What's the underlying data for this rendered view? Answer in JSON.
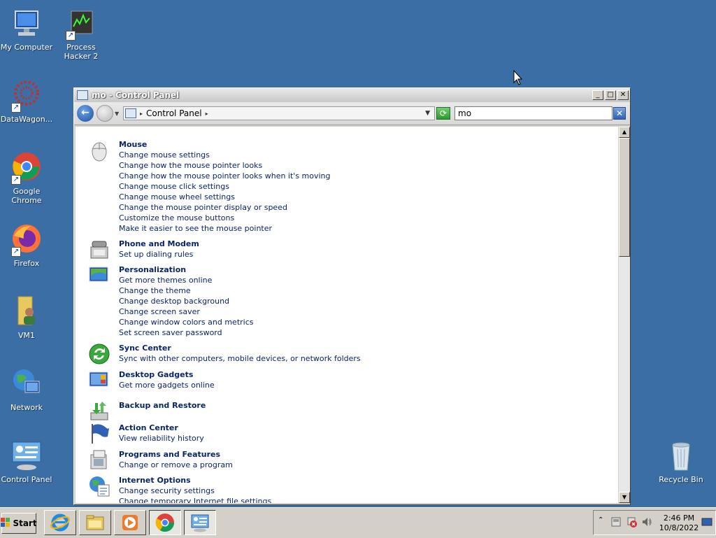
{
  "desktop": {
    "icons": [
      {
        "label": "My Computer"
      },
      {
        "label": "Process Hacker 2"
      },
      {
        "label": "DataWagon..."
      },
      {
        "label": "Google Chrome"
      },
      {
        "label": "Firefox"
      },
      {
        "label": "VM1"
      },
      {
        "label": "Network"
      },
      {
        "label": "Control Panel"
      },
      {
        "label": "Recycle Bin"
      }
    ]
  },
  "window": {
    "title": "mo - Control Panel",
    "address": "Control Panel",
    "search_value": "mo",
    "caption": {
      "minimize": "_",
      "maximize": "□",
      "close": "✕"
    }
  },
  "results": [
    {
      "title": "Mouse",
      "links": [
        "Change mouse settings",
        "Change how the mouse pointer looks",
        "Change how the mouse pointer looks when it's moving",
        "Change mouse click settings",
        "Change mouse wheel settings",
        "Change the mouse pointer display or speed",
        "Customize the mouse buttons",
        "Make it easier to see the mouse pointer"
      ]
    },
    {
      "title": "Phone and Modem",
      "links": [
        "Set up dialing rules"
      ]
    },
    {
      "title": "Personalization",
      "links": [
        "Get more themes online",
        "Change the theme",
        "Change desktop background",
        "Change screen saver",
        "Change window colors and metrics",
        "Set screen saver password"
      ]
    },
    {
      "title": "Sync Center",
      "links": [
        "Sync with other computers, mobile devices, or network folders"
      ]
    },
    {
      "title": "Desktop Gadgets",
      "links": [
        "Get more gadgets online"
      ]
    },
    {
      "title": "Backup and Restore",
      "links": []
    },
    {
      "title": "Action Center",
      "links": [
        "View reliability history"
      ]
    },
    {
      "title": "Programs and Features",
      "links": [
        "Change or remove a program"
      ]
    },
    {
      "title": "Internet Options",
      "links": [
        "Change security settings",
        "Change temporary Internet file settings"
      ]
    }
  ],
  "taskbar": {
    "start_label": "Start",
    "time": "2:46 PM",
    "date": "10/8/2022"
  }
}
